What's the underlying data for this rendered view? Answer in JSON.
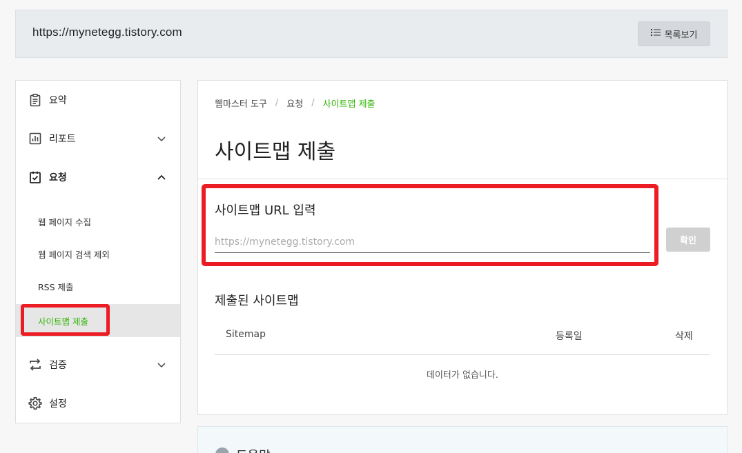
{
  "header": {
    "site_url": "https://mynetegg.tistory.com",
    "list_button_label": "목록보기",
    "list_icon": "list-icon"
  },
  "sidebar": {
    "items": [
      {
        "label": "요약",
        "icon": "clipboard-icon"
      },
      {
        "label": "리포트",
        "icon": "bar-chart-icon"
      },
      {
        "label": "요청",
        "icon": "clipboard-check-icon"
      },
      {
        "label": "검증",
        "icon": "swap-arrows-icon"
      },
      {
        "label": "설정",
        "icon": "gear-icon"
      }
    ],
    "sub_items": [
      {
        "label": "웹 페이지 수집"
      },
      {
        "label": "웹 페이지 검색 제외"
      },
      {
        "label": "RSS 제출"
      },
      {
        "label": "사이트맵 제출"
      }
    ]
  },
  "main": {
    "breadcrumb": [
      "웹마스터 도구",
      "요청",
      "사이트맵 제출"
    ],
    "breadcrumb_separator": "/",
    "title": "사이트맵 제출",
    "url_section": {
      "label": "사이트맵 URL 입력",
      "placeholder": "https://mynetegg.tistory.com",
      "value": "",
      "confirm_label": "확인"
    },
    "submitted": {
      "title": "제출된 사이트맵",
      "columns": [
        "Sitemap",
        "등록일",
        "삭제"
      ],
      "rows": [],
      "empty_message": "데이터가 없습니다."
    },
    "help": {
      "label": "도움말"
    }
  },
  "colors": {
    "accent_green": "#2db400",
    "highlight_red": "#ec1c24",
    "disabled_button": "#d0d0d0"
  }
}
